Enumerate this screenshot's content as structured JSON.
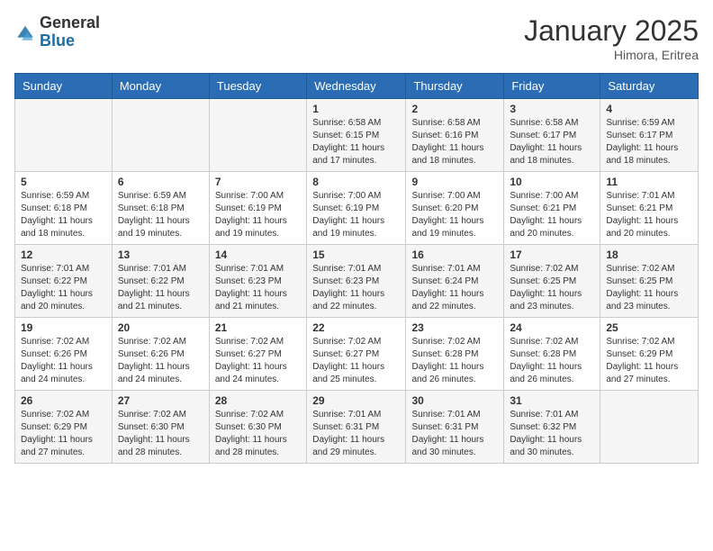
{
  "header": {
    "logo_general": "General",
    "logo_blue": "Blue",
    "month_title": "January 2025",
    "location": "Himora, Eritrea"
  },
  "weekdays": [
    "Sunday",
    "Monday",
    "Tuesday",
    "Wednesday",
    "Thursday",
    "Friday",
    "Saturday"
  ],
  "weeks": [
    [
      {
        "day": "",
        "info": ""
      },
      {
        "day": "",
        "info": ""
      },
      {
        "day": "",
        "info": ""
      },
      {
        "day": "1",
        "info": "Sunrise: 6:58 AM\nSunset: 6:15 PM\nDaylight: 11 hours\nand 17 minutes."
      },
      {
        "day": "2",
        "info": "Sunrise: 6:58 AM\nSunset: 6:16 PM\nDaylight: 11 hours\nand 18 minutes."
      },
      {
        "day": "3",
        "info": "Sunrise: 6:58 AM\nSunset: 6:17 PM\nDaylight: 11 hours\nand 18 minutes."
      },
      {
        "day": "4",
        "info": "Sunrise: 6:59 AM\nSunset: 6:17 PM\nDaylight: 11 hours\nand 18 minutes."
      }
    ],
    [
      {
        "day": "5",
        "info": "Sunrise: 6:59 AM\nSunset: 6:18 PM\nDaylight: 11 hours\nand 18 minutes."
      },
      {
        "day": "6",
        "info": "Sunrise: 6:59 AM\nSunset: 6:18 PM\nDaylight: 11 hours\nand 19 minutes."
      },
      {
        "day": "7",
        "info": "Sunrise: 7:00 AM\nSunset: 6:19 PM\nDaylight: 11 hours\nand 19 minutes."
      },
      {
        "day": "8",
        "info": "Sunrise: 7:00 AM\nSunset: 6:19 PM\nDaylight: 11 hours\nand 19 minutes."
      },
      {
        "day": "9",
        "info": "Sunrise: 7:00 AM\nSunset: 6:20 PM\nDaylight: 11 hours\nand 19 minutes."
      },
      {
        "day": "10",
        "info": "Sunrise: 7:00 AM\nSunset: 6:21 PM\nDaylight: 11 hours\nand 20 minutes."
      },
      {
        "day": "11",
        "info": "Sunrise: 7:01 AM\nSunset: 6:21 PM\nDaylight: 11 hours\nand 20 minutes."
      }
    ],
    [
      {
        "day": "12",
        "info": "Sunrise: 7:01 AM\nSunset: 6:22 PM\nDaylight: 11 hours\nand 20 minutes."
      },
      {
        "day": "13",
        "info": "Sunrise: 7:01 AM\nSunset: 6:22 PM\nDaylight: 11 hours\nand 21 minutes."
      },
      {
        "day": "14",
        "info": "Sunrise: 7:01 AM\nSunset: 6:23 PM\nDaylight: 11 hours\nand 21 minutes."
      },
      {
        "day": "15",
        "info": "Sunrise: 7:01 AM\nSunset: 6:23 PM\nDaylight: 11 hours\nand 22 minutes."
      },
      {
        "day": "16",
        "info": "Sunrise: 7:01 AM\nSunset: 6:24 PM\nDaylight: 11 hours\nand 22 minutes."
      },
      {
        "day": "17",
        "info": "Sunrise: 7:02 AM\nSunset: 6:25 PM\nDaylight: 11 hours\nand 23 minutes."
      },
      {
        "day": "18",
        "info": "Sunrise: 7:02 AM\nSunset: 6:25 PM\nDaylight: 11 hours\nand 23 minutes."
      }
    ],
    [
      {
        "day": "19",
        "info": "Sunrise: 7:02 AM\nSunset: 6:26 PM\nDaylight: 11 hours\nand 24 minutes."
      },
      {
        "day": "20",
        "info": "Sunrise: 7:02 AM\nSunset: 6:26 PM\nDaylight: 11 hours\nand 24 minutes."
      },
      {
        "day": "21",
        "info": "Sunrise: 7:02 AM\nSunset: 6:27 PM\nDaylight: 11 hours\nand 24 minutes."
      },
      {
        "day": "22",
        "info": "Sunrise: 7:02 AM\nSunset: 6:27 PM\nDaylight: 11 hours\nand 25 minutes."
      },
      {
        "day": "23",
        "info": "Sunrise: 7:02 AM\nSunset: 6:28 PM\nDaylight: 11 hours\nand 26 minutes."
      },
      {
        "day": "24",
        "info": "Sunrise: 7:02 AM\nSunset: 6:28 PM\nDaylight: 11 hours\nand 26 minutes."
      },
      {
        "day": "25",
        "info": "Sunrise: 7:02 AM\nSunset: 6:29 PM\nDaylight: 11 hours\nand 27 minutes."
      }
    ],
    [
      {
        "day": "26",
        "info": "Sunrise: 7:02 AM\nSunset: 6:29 PM\nDaylight: 11 hours\nand 27 minutes."
      },
      {
        "day": "27",
        "info": "Sunrise: 7:02 AM\nSunset: 6:30 PM\nDaylight: 11 hours\nand 28 minutes."
      },
      {
        "day": "28",
        "info": "Sunrise: 7:02 AM\nSunset: 6:30 PM\nDaylight: 11 hours\nand 28 minutes."
      },
      {
        "day": "29",
        "info": "Sunrise: 7:01 AM\nSunset: 6:31 PM\nDaylight: 11 hours\nand 29 minutes."
      },
      {
        "day": "30",
        "info": "Sunrise: 7:01 AM\nSunset: 6:31 PM\nDaylight: 11 hours\nand 30 minutes."
      },
      {
        "day": "31",
        "info": "Sunrise: 7:01 AM\nSunset: 6:32 PM\nDaylight: 11 hours\nand 30 minutes."
      },
      {
        "day": "",
        "info": ""
      }
    ]
  ]
}
